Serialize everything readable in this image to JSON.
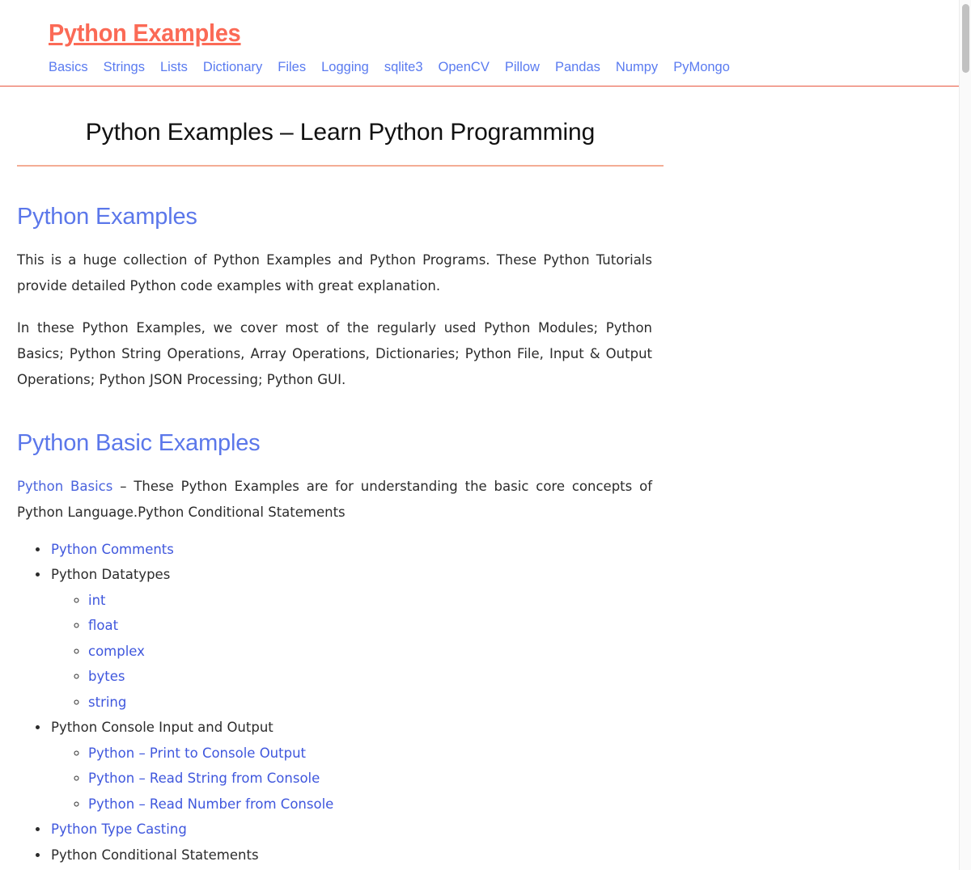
{
  "header": {
    "logo": "Python Examples",
    "nav": [
      {
        "label": "Basics"
      },
      {
        "label": "Strings"
      },
      {
        "label": "Lists"
      },
      {
        "label": "Dictionary"
      },
      {
        "label": "Files"
      },
      {
        "label": "Logging"
      },
      {
        "label": "sqlite3"
      },
      {
        "label": "OpenCV"
      },
      {
        "label": "Pillow"
      },
      {
        "label": "Pandas"
      },
      {
        "label": "Numpy"
      },
      {
        "label": "PyMongo"
      }
    ]
  },
  "main": {
    "page_title": "Python Examples – Learn Python Programming",
    "section1": {
      "heading": "Python Examples",
      "paragraph1": "This is a huge collection of Python Examples and Python Programs. These Python Tutorials provide detailed Python code examples with great explanation.",
      "paragraph2": "In these Python Examples, we cover most of the regularly used Python Modules; Python Basics; Python String Operations, Array Operations, Dictionaries; Python File, Input & Output Operations; Python JSON Processing; Python GUI."
    },
    "section2": {
      "heading": "Python Basic Examples",
      "intro_link": "Python Basics",
      "intro_text": " – These Python Examples are for understanding the basic core concepts of Python Language.Python Conditional Statements",
      "items": [
        {
          "label": "Python Comments",
          "link": true
        },
        {
          "label": "Python Datatypes",
          "link": false,
          "children": [
            {
              "label": "int",
              "link": true
            },
            {
              "label": "float",
              "link": true
            },
            {
              "label": "complex",
              "link": true
            },
            {
              "label": "bytes",
              "link": true
            },
            {
              "label": "string",
              "link": true
            }
          ]
        },
        {
          "label": "Python Console Input and Output",
          "link": false,
          "children": [
            {
              "label": "Python – Print to Console Output",
              "link": true
            },
            {
              "label": "Python – Read String from Console",
              "link": true
            },
            {
              "label": "Python – Read Number from Console",
              "link": true
            }
          ]
        },
        {
          "label": "Python Type Casting",
          "link": true
        },
        {
          "label": "Python Conditional Statements",
          "link": false
        }
      ]
    }
  },
  "colors": {
    "brand": "#fb6a56",
    "nav_link": "#5a7bf0",
    "heading_blue": "#5b77ea",
    "body_text": "#2b2b2b",
    "rule": "#f4ac95",
    "header_border": "#e8563f",
    "list_link": "#3f57dd"
  },
  "scrollbar": {
    "present": true
  }
}
